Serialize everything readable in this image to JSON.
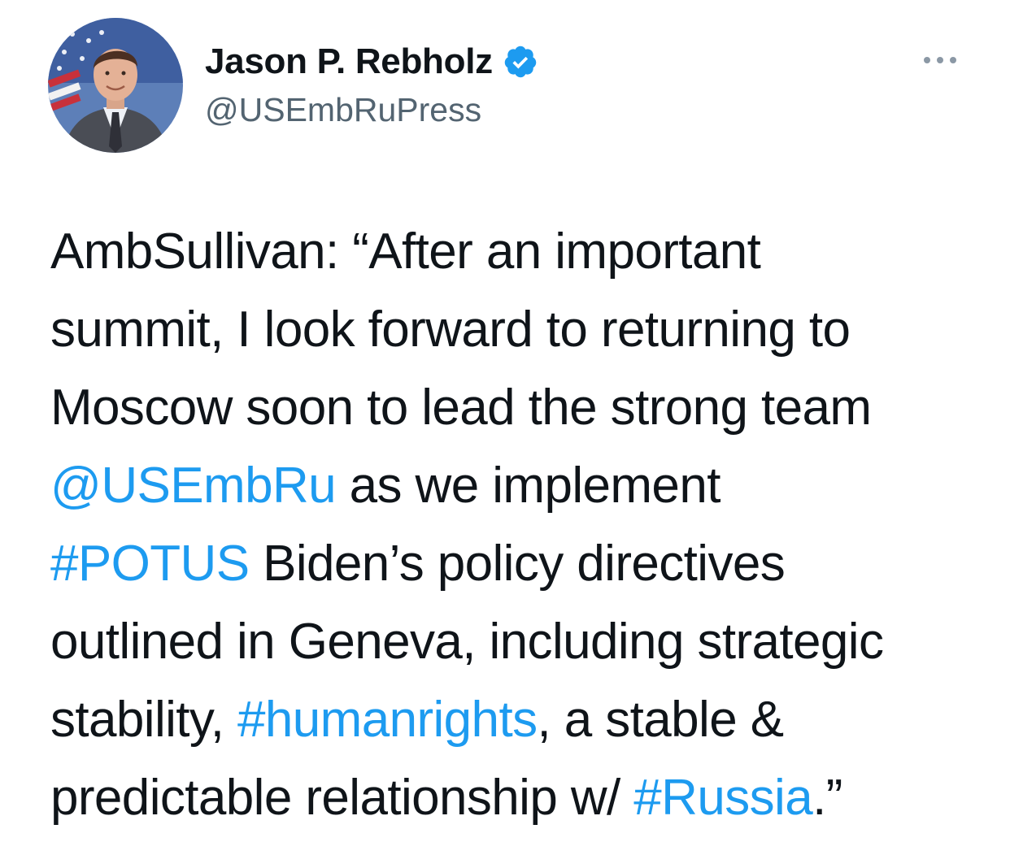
{
  "author": {
    "display_name": "Jason P. Rebholz",
    "handle": "@USEmbRuPress",
    "verified": true,
    "avatar_icon": "profile-photo-icon"
  },
  "menu": {
    "icon": "more-options-icon"
  },
  "colors": {
    "link": "#1d9bf0",
    "text": "#0f1419",
    "secondary": "#536471",
    "verified_badge": "#1d9bf0"
  },
  "tweet": {
    "lines": [
      [
        {
          "text": "AmbSullivan: “After an important",
          "type": "text"
        }
      ],
      [
        {
          "text": "summit, I look forward to returning to",
          "type": "text"
        }
      ],
      [
        {
          "text": "Moscow soon to lead the strong team",
          "type": "text"
        }
      ],
      [
        {
          "text": "@USEmbRu",
          "type": "mention"
        },
        {
          "text": " as we implement",
          "type": "text"
        }
      ],
      [
        {
          "text": "#POTUS",
          "type": "hashtag"
        },
        {
          "text": " Biden’s policy directives",
          "type": "text"
        }
      ],
      [
        {
          "text": "outlined in Geneva, including strategic",
          "type": "text"
        }
      ],
      [
        {
          "text": "stability, ",
          "type": "text"
        },
        {
          "text": "#humanrights",
          "type": "hashtag"
        },
        {
          "text": ", a stable &",
          "type": "text"
        }
      ],
      [
        {
          "text": "predictable relationship w/ ",
          "type": "text"
        },
        {
          "text": "#Russia",
          "type": "hashtag"
        },
        {
          "text": ".”",
          "type": "text"
        }
      ]
    ]
  }
}
